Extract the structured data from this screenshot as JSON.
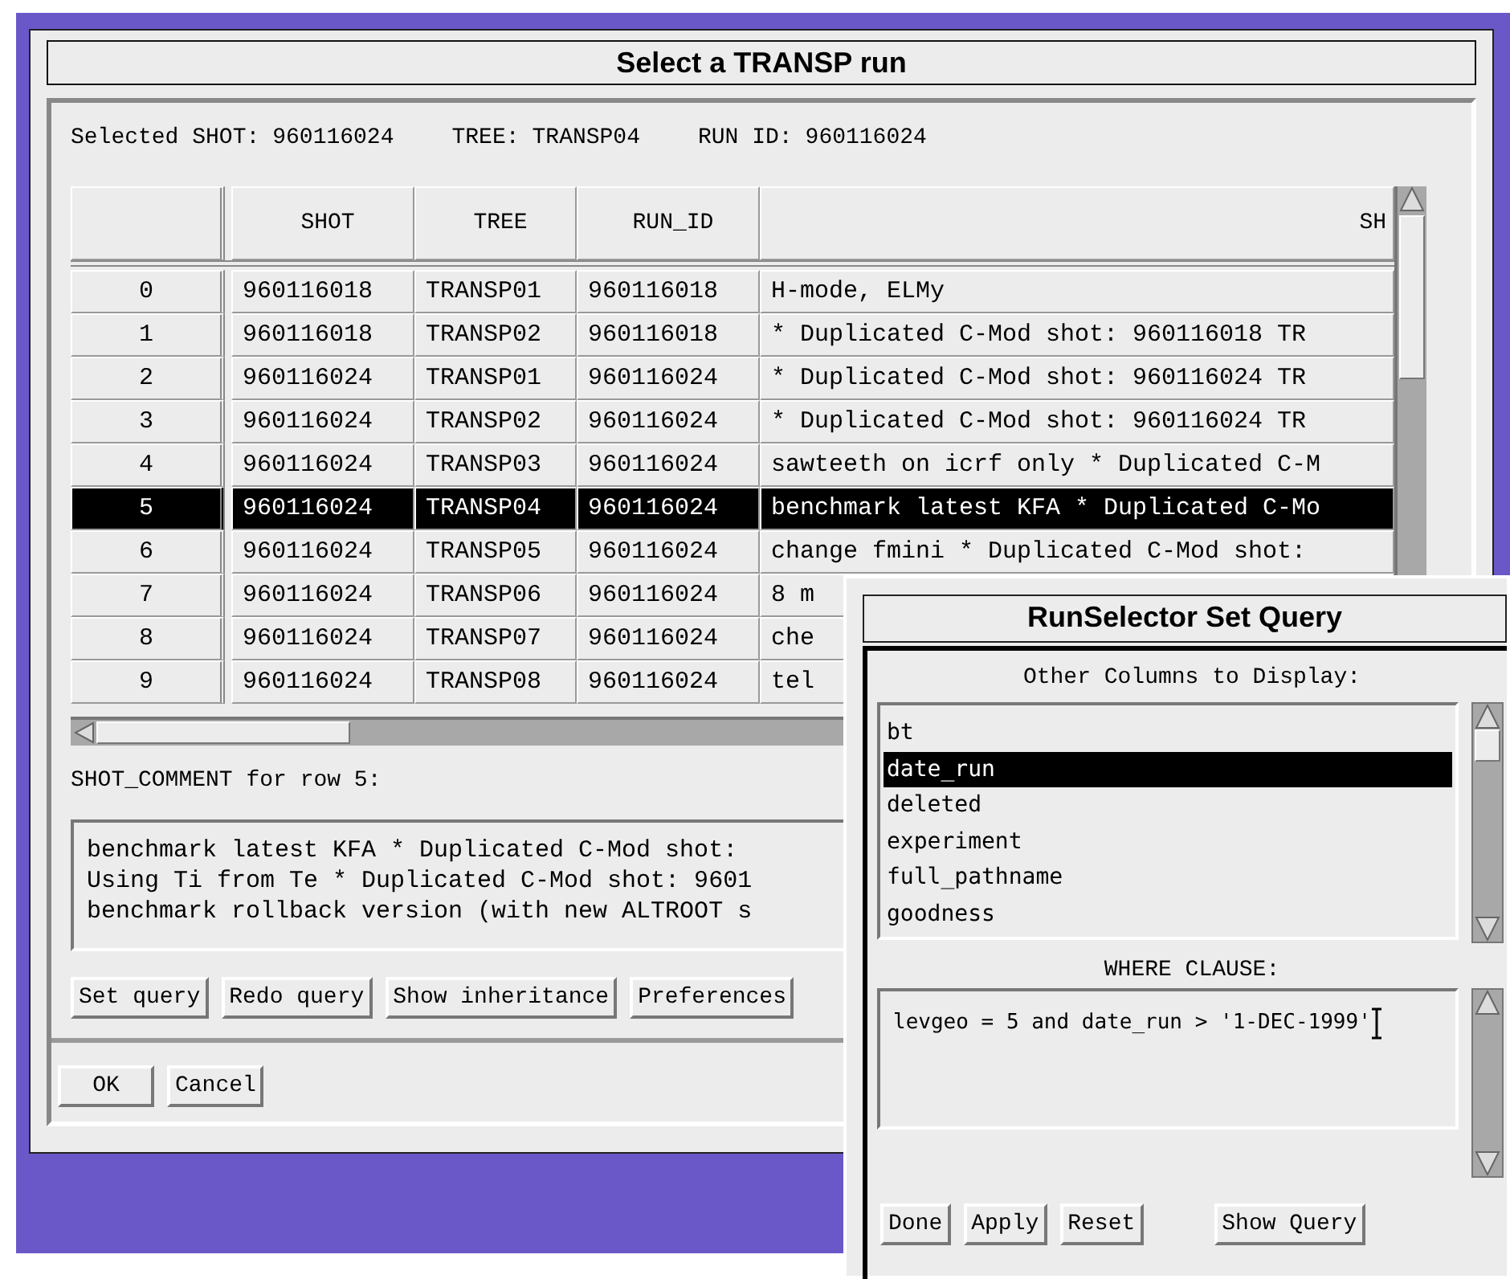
{
  "window": {
    "title": "Select a TRANSP run"
  },
  "selection": [
    {
      "label": "Selected SHOT:",
      "value": "960116024"
    },
    {
      "label": "TREE:",
      "value": "TRANSP04"
    },
    {
      "label": "RUN ID:",
      "value": "960116024"
    }
  ],
  "table": {
    "columns": [
      "SHOT",
      "TREE",
      "RUN_ID",
      "SH"
    ],
    "rows": [
      {
        "index": "0",
        "cells": [
          "960116018",
          "TRANSP01",
          "960116018",
          "H-mode, ELMy"
        ],
        "selected": false
      },
      {
        "index": "1",
        "cells": [
          "960116018",
          "TRANSP02",
          "960116018",
          "* Duplicated C-Mod shot: 960116018   TR"
        ],
        "selected": false
      },
      {
        "index": "2",
        "cells": [
          "960116024",
          "TRANSP01",
          "960116024",
          "* Duplicated C-Mod shot: 960116024   TR"
        ],
        "selected": false
      },
      {
        "index": "3",
        "cells": [
          "960116024",
          "TRANSP02",
          "960116024",
          "* Duplicated C-Mod shot: 960116024   TR"
        ],
        "selected": false
      },
      {
        "index": "4",
        "cells": [
          "960116024",
          "TRANSP03",
          "960116024",
          "sawteeth on icrf only * Duplicated C-M"
        ],
        "selected": false
      },
      {
        "index": "5",
        "cells": [
          "960116024",
          "TRANSP04",
          "960116024",
          "benchmark latest KFA * Duplicated C-Mo"
        ],
        "selected": true
      },
      {
        "index": "6",
        "cells": [
          "960116024",
          "TRANSP05",
          "960116024",
          "change fmini * Duplicated C-Mod shot:"
        ],
        "selected": false
      },
      {
        "index": "7",
        "cells": [
          "960116024",
          "TRANSP06",
          "960116024",
          "8 m"
        ],
        "selected": false
      },
      {
        "index": "8",
        "cells": [
          "960116024",
          "TRANSP07",
          "960116024",
          "che"
        ],
        "selected": false
      },
      {
        "index": "9",
        "cells": [
          "960116024",
          "TRANSP08",
          "960116024",
          "tel"
        ],
        "selected": false
      }
    ]
  },
  "comment": {
    "label": "SHOT_COMMENT for row 5:",
    "lines": [
      "benchmark latest KFA * Duplicated C-Mod shot:",
      "Using Ti from Te * Duplicated C-Mod shot: 9601",
      "benchmark rollback version (with new ALTROOT s"
    ]
  },
  "buttons": [
    "Set query",
    "Redo query",
    "Show inheritance",
    "Preferences"
  ],
  "dialog_buttons": [
    "OK",
    "Cancel"
  ],
  "query_dialog": {
    "title": "RunSelector Set Query",
    "list_label": "Other Columns to Display:",
    "items": [
      {
        "label": "bt",
        "selected": false
      },
      {
        "label": "date_run",
        "selected": true
      },
      {
        "label": "deleted",
        "selected": false
      },
      {
        "label": "experiment",
        "selected": false
      },
      {
        "label": "full_pathname",
        "selected": false
      },
      {
        "label": "goodness",
        "selected": false
      }
    ],
    "where_label": "WHERE CLAUSE:",
    "where_value": "levgeo = 5 and date_run > '1-DEC-1999'",
    "buttons": [
      "Done",
      "Apply",
      "Reset"
    ],
    "query_button": "Show Query"
  }
}
